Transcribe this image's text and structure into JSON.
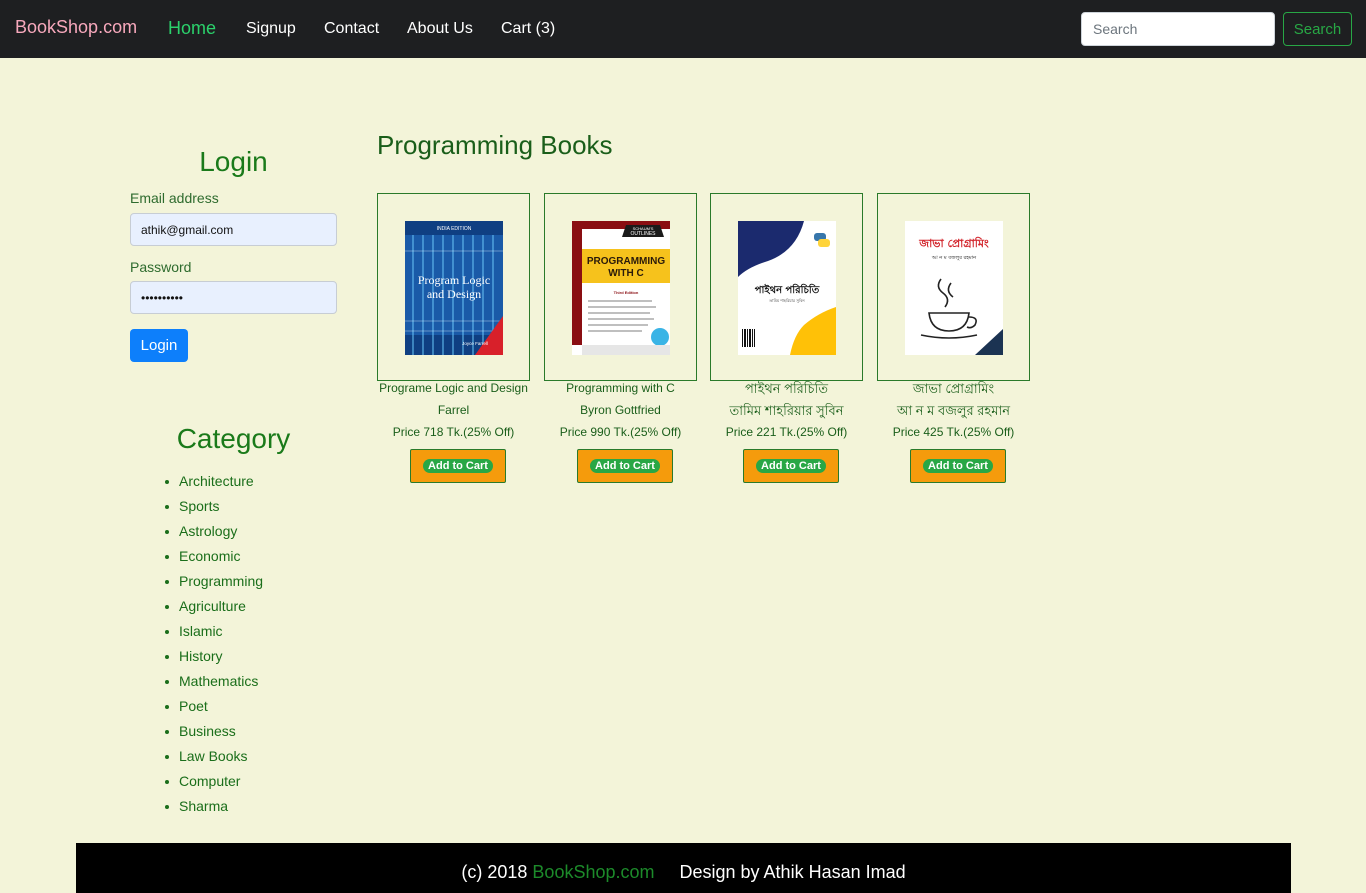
{
  "navbar": {
    "brand": "BookShop.com",
    "links": [
      "Home",
      "Signup",
      "Contact",
      "About Us",
      "Cart (3)"
    ],
    "active_link": "Home",
    "search_placeholder": "Search",
    "search_button": "Search"
  },
  "login": {
    "title": "Login",
    "email_label": "Email address",
    "email_value": "athik@gmail.com",
    "password_label": "Password",
    "password_value": "••••••••••",
    "button": "Login"
  },
  "categories": {
    "title": "Category",
    "items": [
      "Architecture",
      "Sports",
      "Astrology",
      "Economic",
      "Programming",
      "Agriculture",
      "Islamic",
      "History",
      "Mathematics",
      "Poet",
      "Business",
      "Law Books",
      "Computer",
      "Sharma"
    ]
  },
  "main": {
    "title": "Programming Books",
    "add_to_cart_label": "Add to Cart",
    "books": [
      {
        "title": "Programe Logic and Design",
        "author": "Farrel",
        "price": "Price 718 Tk.(25% Off)",
        "cover": {
          "top_label": "INDIA EDITION",
          "title_line1": "Program Logic",
          "title_line2": "and Design",
          "author": "Joyce Farrell"
        }
      },
      {
        "title": "Programming with C",
        "author": "Byron Gottfried",
        "price": "Price 990 Tk.(25% Off)",
        "cover": {
          "badge_line1": "SCHAUM'S",
          "badge_line2": "OUTLINES",
          "title_line1": "PROGRAMMING",
          "title_line2": "WITH C",
          "edition": "Third Edition"
        }
      },
      {
        "title": "পাইথন পরিচিতি",
        "author": "তামিম শাহরিয়ার সুবিন",
        "price": "Price 221 Tk.(25% Off)",
        "cover": {
          "title": "পাইথন পরিচিতি",
          "author": "তামিম শাহরিয়ার সুবিন"
        }
      },
      {
        "title": "জাভা প্রোগ্রামিং",
        "author": "আ ন ম বজলুর রহমান",
        "price": "Price 425 Tk.(25% Off)",
        "cover": {
          "title": "জাভা প্রোগ্রামিং",
          "author": "আ ন ম বজলুর রহমান"
        }
      }
    ]
  },
  "footer": {
    "prefix": "(c) 2018 ",
    "brand": "BookShop.com",
    "credit": "     Design by Athik Hasan Imad"
  },
  "colors": {
    "page_bg": "#f3f4d9",
    "navbar_bg": "#1e1f21",
    "brand": "#f7a8bc",
    "active_link": "#2bd16b",
    "primary_text": "#1a7a1a",
    "login_button": "#0d7ffb",
    "cart_button": "#f59b0c",
    "cart_pill": "#28a745"
  }
}
